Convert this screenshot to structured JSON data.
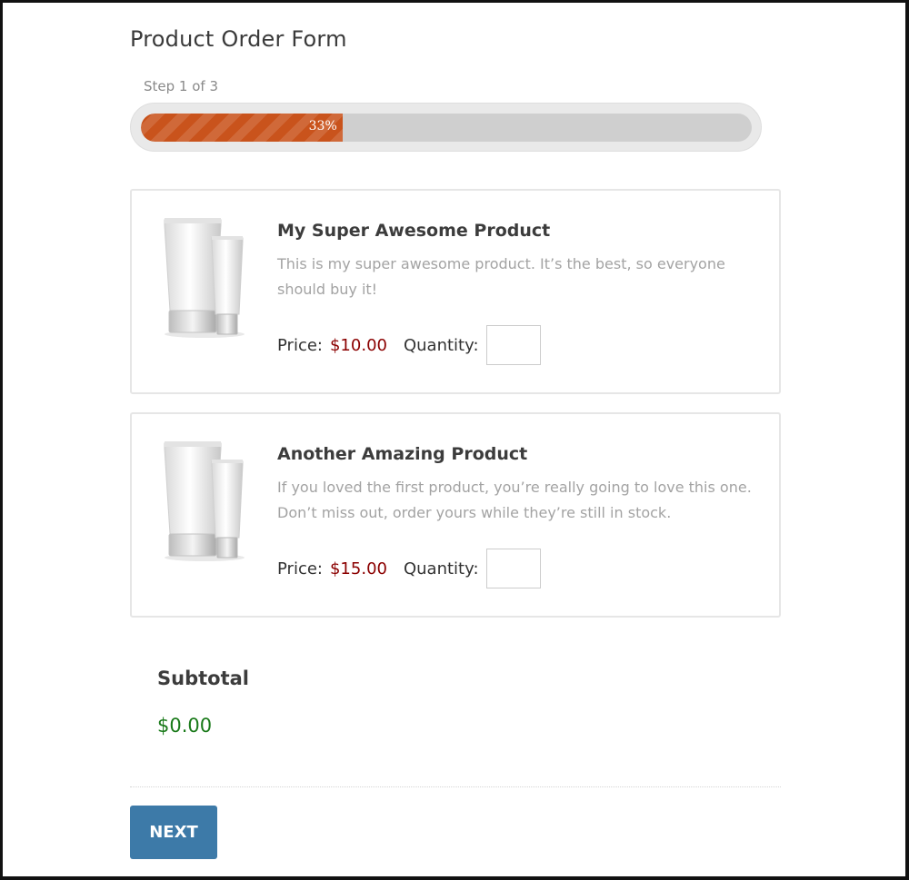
{
  "form": {
    "title": "Product Order Form",
    "step_text": "Step 1 of 3",
    "progress_label": "33%",
    "progress_fraction": 0.33
  },
  "products": [
    {
      "name": "My Super Awesome Product",
      "description": "This is my super awesome product. It’s the best, so everyone should buy it!",
      "price_label": "Price:",
      "price": "$10.00",
      "quantity_label": "Quantity:",
      "quantity_value": "",
      "image_icon": "product-tubes-icon"
    },
    {
      "name": "Another Amazing Product",
      "description": "If you loved the first product, you’re really going to love this one. Don’t miss out, order yours while they’re still in stock.",
      "price_label": "Price:",
      "price": "$15.00",
      "quantity_label": "Quantity:",
      "quantity_value": "",
      "image_icon": "product-tubes-icon"
    }
  ],
  "subtotal": {
    "label": "Subtotal",
    "value": "$0.00"
  },
  "actions": {
    "next_label": "NEXT"
  },
  "colors": {
    "progress_fill": "#c9531c",
    "price": "#8b0000",
    "subtotal": "#1a7a1a",
    "button": "#3d7aa8"
  }
}
